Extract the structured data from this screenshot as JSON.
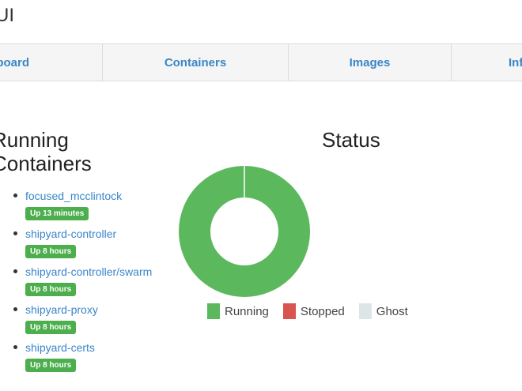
{
  "app": {
    "title": "UI"
  },
  "nav": [
    {
      "label": "Dashboard"
    },
    {
      "label": "Containers"
    },
    {
      "label": "Images"
    },
    {
      "label": "Info"
    }
  ],
  "running": {
    "title": "Running Containers",
    "containers": [
      {
        "name": "focused_mcclintock",
        "uptime": "Up 13 minutes"
      },
      {
        "name": "shipyard-controller",
        "uptime": "Up 8 hours"
      },
      {
        "name": "shipyard-controller/swarm",
        "uptime": "Up 8 hours"
      },
      {
        "name": "shipyard-proxy",
        "uptime": "Up 8 hours"
      },
      {
        "name": "shipyard-certs",
        "uptime": "Up 8 hours"
      }
    ]
  },
  "status": {
    "title": "Status",
    "legend": [
      {
        "label": "Running",
        "color": "#5cb85c"
      },
      {
        "label": "Stopped",
        "color": "#d9534f"
      },
      {
        "label": "Ghost",
        "color": "#dde6e6"
      }
    ],
    "values": {
      "running": 5,
      "stopped": 0,
      "ghost": 0
    }
  }
}
